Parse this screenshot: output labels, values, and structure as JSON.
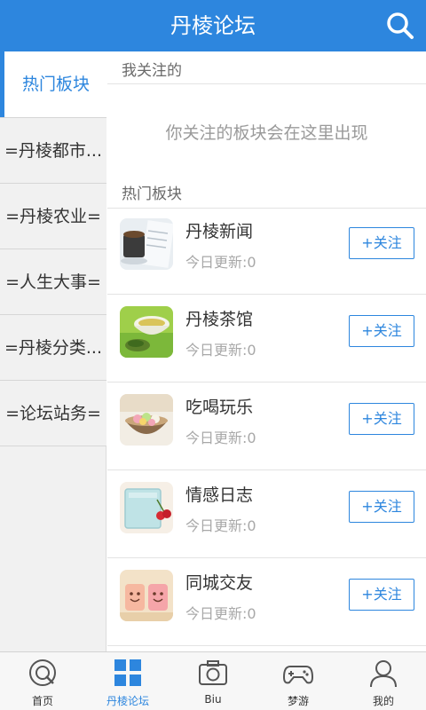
{
  "header": {
    "title": "丹棱论坛"
  },
  "sidebar": {
    "items": [
      {
        "label": "热门板块",
        "active": true
      },
      {
        "label": "=丹棱都市..."
      },
      {
        "label": "=丹棱农业="
      },
      {
        "label": "=人生大事="
      },
      {
        "label": "=丹棱分类..."
      },
      {
        "label": "=论坛站务="
      }
    ]
  },
  "main": {
    "followed_label": "我关注的",
    "followed_empty": "你关注的板块会在这里出现",
    "hot_label": "热门板块",
    "boards": [
      {
        "name": "丹棱新闻",
        "update": "今日更新:0",
        "follow_label": "+关注",
        "thumb_icon": "newspaper-coffee-thumb"
      },
      {
        "name": "丹棱茶馆",
        "update": "今日更新:0",
        "follow_label": "+关注",
        "thumb_icon": "green-tea-thumb"
      },
      {
        "name": "吃喝玩乐",
        "update": "今日更新:0",
        "follow_label": "+关注",
        "thumb_icon": "dessert-bowl-thumb"
      },
      {
        "name": "情感日志",
        "update": "今日更新:0",
        "follow_label": "+关注",
        "thumb_icon": "notebook-cherry-thumb"
      },
      {
        "name": "同城交友",
        "update": "今日更新:0",
        "follow_label": "+关注",
        "thumb_icon": "smiley-cups-thumb"
      }
    ]
  },
  "tabbar": {
    "tabs": [
      {
        "label": "首页",
        "icon": "home-icon"
      },
      {
        "label": "丹棱论坛",
        "icon": "forum-grid-icon",
        "active": true
      },
      {
        "label": "Biu",
        "icon": "camera-icon"
      },
      {
        "label": "梦游",
        "icon": "gamepad-icon"
      },
      {
        "label": "我的",
        "icon": "user-icon"
      }
    ]
  },
  "colors": {
    "accent": "#2d86de",
    "sidebar_bg": "#f1f1f1",
    "muted_text": "#a8a8a8"
  }
}
